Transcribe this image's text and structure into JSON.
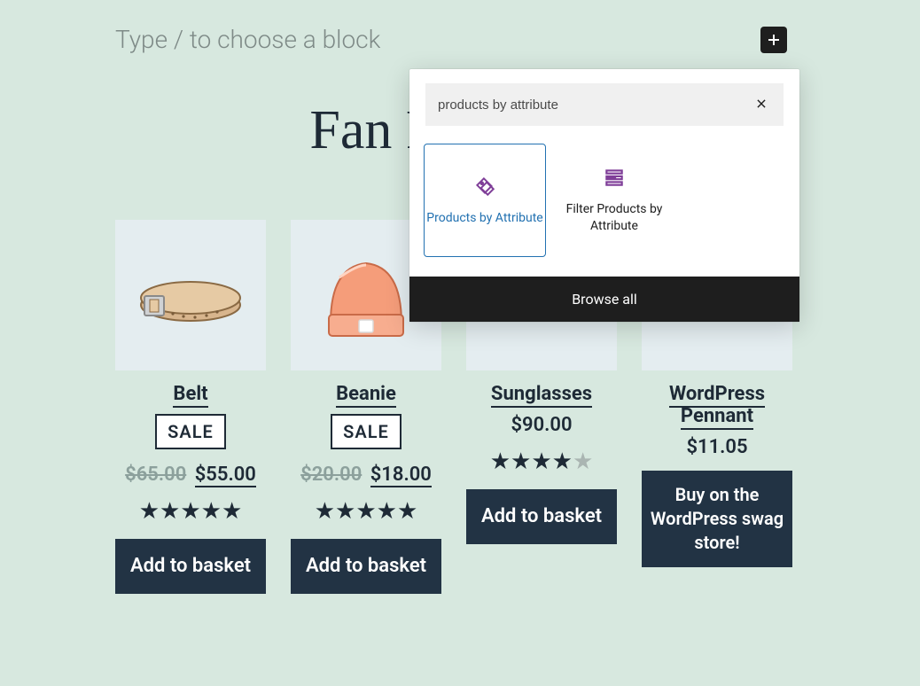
{
  "editor": {
    "placeholder": "Type / to choose a block"
  },
  "heading": "Fan Favorites",
  "inserter": {
    "search_value": "products by attribute",
    "items": [
      {
        "label": "Products by Attribute"
      },
      {
        "label": "Filter Products by Attribute"
      }
    ],
    "browse_all": "Browse all"
  },
  "products": [
    {
      "title": "Belt",
      "sale": "SALE",
      "old_price": "$65.00",
      "price": "$55.00",
      "rating": 5,
      "cta": "Add to basket"
    },
    {
      "title": "Beanie",
      "sale": "SALE",
      "old_price": "$20.00",
      "price": "$18.00",
      "rating": 5,
      "cta": "Add to basket"
    },
    {
      "title": "Sunglasses",
      "price": "$90.00",
      "rating": 4,
      "cta": "Add to basket"
    },
    {
      "title": "WordPress Pennant",
      "price": "$11.05",
      "cta": "Buy on the WordPress swag store!"
    }
  ]
}
